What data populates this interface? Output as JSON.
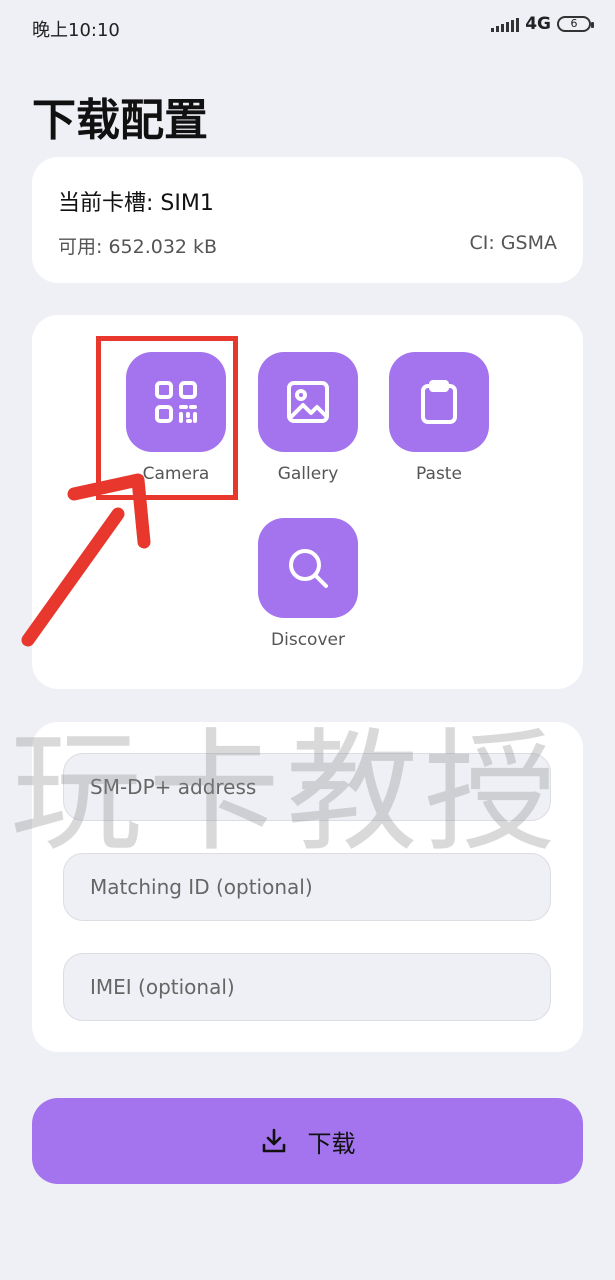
{
  "status_bar": {
    "time": "晚上10:10",
    "network": "4G",
    "battery": "6"
  },
  "page_title": "下载配置",
  "sim_card": {
    "slot": "当前卡槽: SIM1",
    "available": "可用: 652.032 kB",
    "ci": "CI: GSMA"
  },
  "actions": [
    {
      "label": "Camera",
      "icon": "qr-code-icon"
    },
    {
      "label": "Gallery",
      "icon": "image-icon"
    },
    {
      "label": "Paste",
      "icon": "clipboard-icon"
    },
    {
      "label": "Discover",
      "icon": "search-icon"
    }
  ],
  "form": {
    "smdp_placeholder": "SM-DP+ address",
    "matching_id_placeholder": "Matching ID (optional)",
    "imei_placeholder": "IMEI (optional)"
  },
  "download_button": {
    "label": "下载",
    "icon": "download-icon"
  },
  "watermark": "玩卡教授",
  "colors": {
    "accent": "#a374ee",
    "background": "#eff0f5",
    "annotation": "#e8372c"
  }
}
